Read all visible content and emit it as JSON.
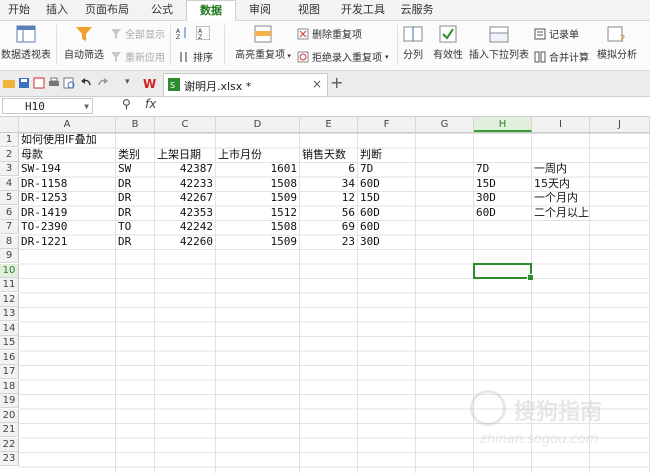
{
  "menu": {
    "tabs": [
      "开始",
      "插入",
      "页面布局",
      "公式",
      "数据",
      "审阅",
      "视图",
      "开发工具",
      "云服务"
    ],
    "active": "数据",
    "colors": {
      "active_text": "#1f7a1f"
    }
  },
  "ribbon": {
    "pivot_label": "数据透视表",
    "autofilter_label": "自动筛选",
    "show_all_label": "全部显示",
    "reapply_label": "重新应用",
    "sort_label": "排序",
    "highlight_dup_label": "高亮重复项",
    "delete_dup_label": "删除重复项",
    "reject_dup_label": "拒绝录入重复项",
    "split_label": "分列",
    "validity_label": "有效性",
    "insert_dropdown_label": "插入下拉列表",
    "record_label": "记录单",
    "merge_calc_label": "合并计算",
    "sim_analysis_label": "模拟分析"
  },
  "document": {
    "tab_name": "谢明月.xlsx *",
    "close_glyph": "×",
    "add_glyph": "+"
  },
  "formula_bar": {
    "name_box": "H10",
    "fx": "fx",
    "content": ""
  },
  "columns": [
    "A",
    "B",
    "C",
    "D",
    "E",
    "F",
    "G",
    "H",
    "I",
    "J"
  ],
  "selected_column": "H",
  "rows": [
    "1",
    "2",
    "3",
    "4",
    "5",
    "6",
    "7",
    "8",
    "9",
    "10",
    "11",
    "12",
    "13",
    "14",
    "15",
    "16",
    "17",
    "18",
    "19",
    "20",
    "21",
    "22",
    "23"
  ],
  "selected_row": "10",
  "sheet": {
    "a1_title": "如何使用IF叠加",
    "headers": [
      "母款",
      "类别",
      "上架日期",
      "上市月份",
      "销售天数",
      "判断"
    ],
    "data_rows": [
      [
        "SW-194",
        "SW",
        "42387",
        "1601",
        "6",
        "7D"
      ],
      [
        "DR-1158",
        "DR",
        "42233",
        "1508",
        "34",
        "60D"
      ],
      [
        "DR-1253",
        "DR",
        "42267",
        "1509",
        "12",
        "15D"
      ],
      [
        "DR-1419",
        "DR",
        "42353",
        "1512",
        "56",
        "60D"
      ],
      [
        "TO-2390",
        "TO",
        "42242",
        "1508",
        "69",
        "60D"
      ],
      [
        "DR-1221",
        "DR",
        "42260",
        "1509",
        "23",
        "30D"
      ]
    ],
    "lookup": [
      [
        "7D",
        "一周内"
      ],
      [
        "15D",
        "15天内"
      ],
      [
        "30D",
        "一个月内"
      ],
      [
        "60D",
        "二个月以上"
      ]
    ]
  },
  "watermark": {
    "text": "搜狗指南",
    "url": "zhinan.sogou.com"
  }
}
